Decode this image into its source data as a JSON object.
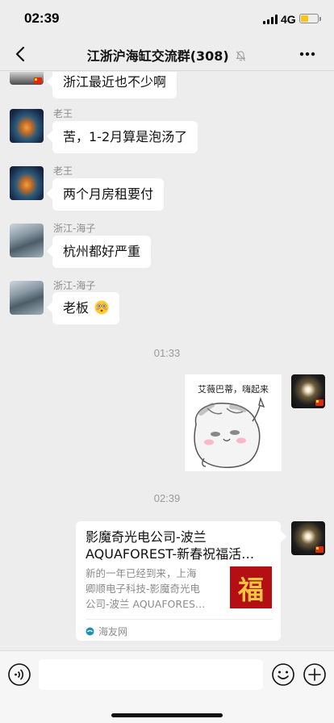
{
  "status_bar": {
    "time": "02:39",
    "network": "4G"
  },
  "nav": {
    "title": "江浙沪海缸交流群(308)",
    "back_icon": "chevron-left-icon",
    "mute_icon": "bell-muted-icon",
    "more_icon": "more-dots-icon"
  },
  "messages": [
    {
      "sender": "",
      "text": "浙江最近也不少啊"
    },
    {
      "sender": "老王",
      "text": "苦，1-2月算是泡汤了"
    },
    {
      "sender": "老王",
      "text": "两个月房租要付"
    },
    {
      "sender": "浙江-海子",
      "text": "杭州都好严重"
    },
    {
      "sender": "浙江-海子",
      "text": "老板"
    }
  ],
  "timestamps": [
    "01:33",
    "02:39"
  ],
  "sticker": {
    "caption": "艾薇巴蒂，嗨起来"
  },
  "link_card": {
    "title_line1": "影魔奇光电公司-波兰",
    "title_line2": "AQUAFOREST-新春祝福活…",
    "desc_line1": "新的一年已经到来，上海",
    "desc_line2": "卿顺电子科技-影魔奇光电",
    "desc_line3": "公司-波兰 AQUAFORES…",
    "thumb_char": "福",
    "source": "海友网"
  },
  "input_bar": {
    "voice_icon": "voice-icon",
    "emoji_icon": "emoji-icon",
    "plus_icon": "plus-icon",
    "placeholder": ""
  },
  "colors": {
    "background": "#ededed",
    "bubble": "#ffffff",
    "badge": "#de2910"
  }
}
